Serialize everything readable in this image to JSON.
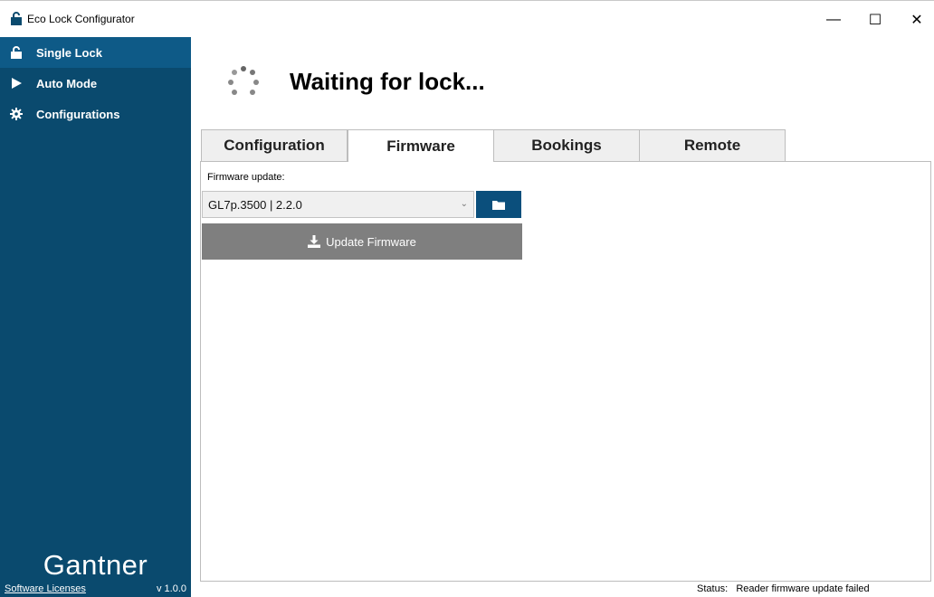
{
  "window": {
    "title": "Eco Lock Configurator",
    "minimize_glyph": "—",
    "maximize_glyph": "☐",
    "close_glyph": "✕"
  },
  "sidebar": {
    "items": [
      {
        "label": "Single Lock",
        "icon": "unlock-icon",
        "active": true
      },
      {
        "label": "Auto Mode",
        "icon": "play-icon",
        "active": false
      },
      {
        "label": "Configurations",
        "icon": "gear-icon",
        "active": false
      }
    ],
    "brand": "Gantner",
    "footer_link": "Software Licenses",
    "version": "v 1.0.0"
  },
  "header": {
    "status_heading": "Waiting for lock..."
  },
  "tabs": [
    {
      "label": "Configuration",
      "active": false
    },
    {
      "label": "Firmware",
      "active": true
    },
    {
      "label": "Bookings",
      "active": false
    },
    {
      "label": "Remote",
      "active": false
    }
  ],
  "firmware": {
    "section_label": "Firmware update:",
    "selected_firmware": "GL7p.3500 | 2.2.0",
    "update_button_label": "Update Firmware"
  },
  "status_bar": {
    "label": "Status:",
    "value": "Reader firmware update failed"
  },
  "colors": {
    "sidebar_bg": "#0a4a6e",
    "sidebar_active": "#0e5a87",
    "accent_button": "#0b4f7c",
    "disabled_button": "#7f7f7f"
  }
}
